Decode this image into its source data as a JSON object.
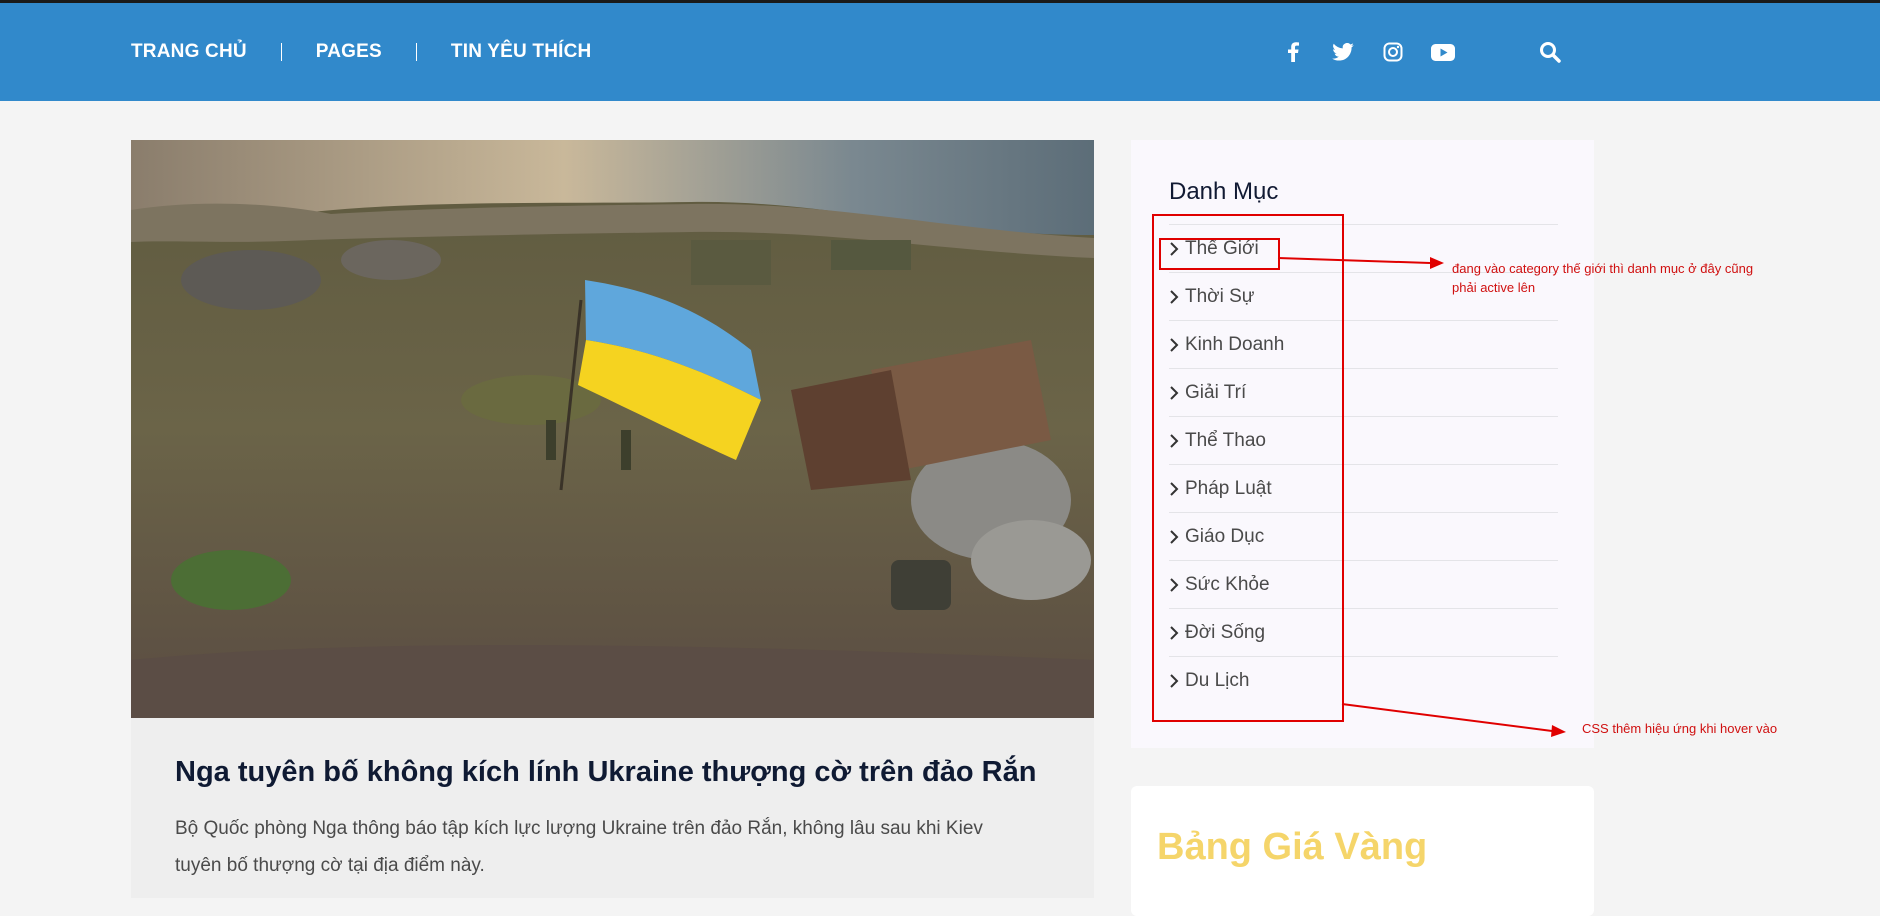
{
  "nav": {
    "links": [
      "TRANG CHỦ",
      "PAGES",
      "TIN YÊU THÍCH"
    ],
    "social_icons": [
      "facebook-icon",
      "twitter-icon",
      "instagram-icon",
      "youtube-icon"
    ],
    "search_icon": "search-icon",
    "bg_color": "#3189cb"
  },
  "post": {
    "image": "aerial photo of soldiers raising a blue-yellow flag on a rocky island by the sea",
    "title": "Nga tuyên bố không kích lính Ukraine thượng cờ trên đảo Rắn",
    "excerpt": "Bộ Quốc phòng Nga thông báo tập kích lực lượng Ukraine trên đảo Rắn, không lâu sau khi Kiev tuyên bố thượng cờ tại địa điểm này."
  },
  "sidebar": {
    "title": "Danh Mục",
    "categories": [
      "Thế Giới",
      "Thời Sự",
      "Kinh Doanh",
      "Giải Trí",
      "Thể Thao",
      "Pháp Luật",
      "Giáo Dục",
      "Sức Khỏe",
      "Đời Sống",
      "Du Lịch"
    ]
  },
  "gold": {
    "title": "Bảng Giá Vàng"
  },
  "annotations": {
    "note_active": "đang vào category thế giới thì danh mục ở đây cũng phải active lên",
    "note_hover": "CSS thêm hiệu ứng khi hover vào",
    "color": "#e00000"
  }
}
